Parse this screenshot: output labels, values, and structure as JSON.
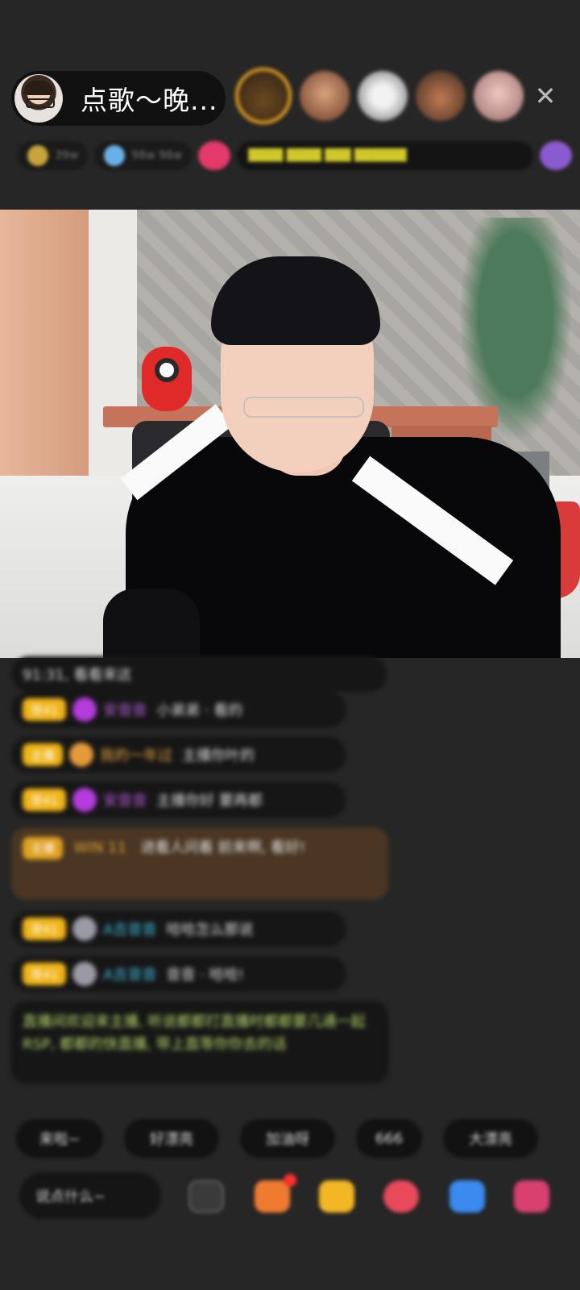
{
  "header": {
    "host_name": "点歌～晚...",
    "close_symbol": "✕",
    "info_chips": [
      "39w",
      "98w 98w",
      "",
      "████ ████ ███ ██████"
    ]
  },
  "chat": {
    "messages": [
      {
        "text": "91:31, 看看来这"
      },
      {
        "badge": "哥41",
        "user": "安音音",
        "text": "小弟弟 · 看的"
      },
      {
        "badge": "主播",
        "user": "我的一年过",
        "text": "主播你叶的"
      },
      {
        "badge": "哥41",
        "user": "安音音",
        "text": "主播你好 要再都"
      },
      {
        "badge": "主播",
        "user": "WIN 11",
        "text": "进看人问着 前来啊, 看好!"
      },
      {
        "badge": "哥41",
        "user": "A吉音音",
        "text": "哈哈怎么那说"
      },
      {
        "badge": "哥41",
        "user": "A吉音音",
        "text": "音音 · 哈哈!"
      },
      {
        "text": "直播间欢迎来主播, 听说都都打直播时都都要几通一起RSP, 都都的快直播, 带上直等你你去的话"
      }
    ]
  },
  "quick_replies": [
    "来啦~",
    "好漂亮",
    "加油呀",
    "666",
    "大漂亮"
  ],
  "bottom": {
    "input_placeholder": "说点什么~"
  }
}
